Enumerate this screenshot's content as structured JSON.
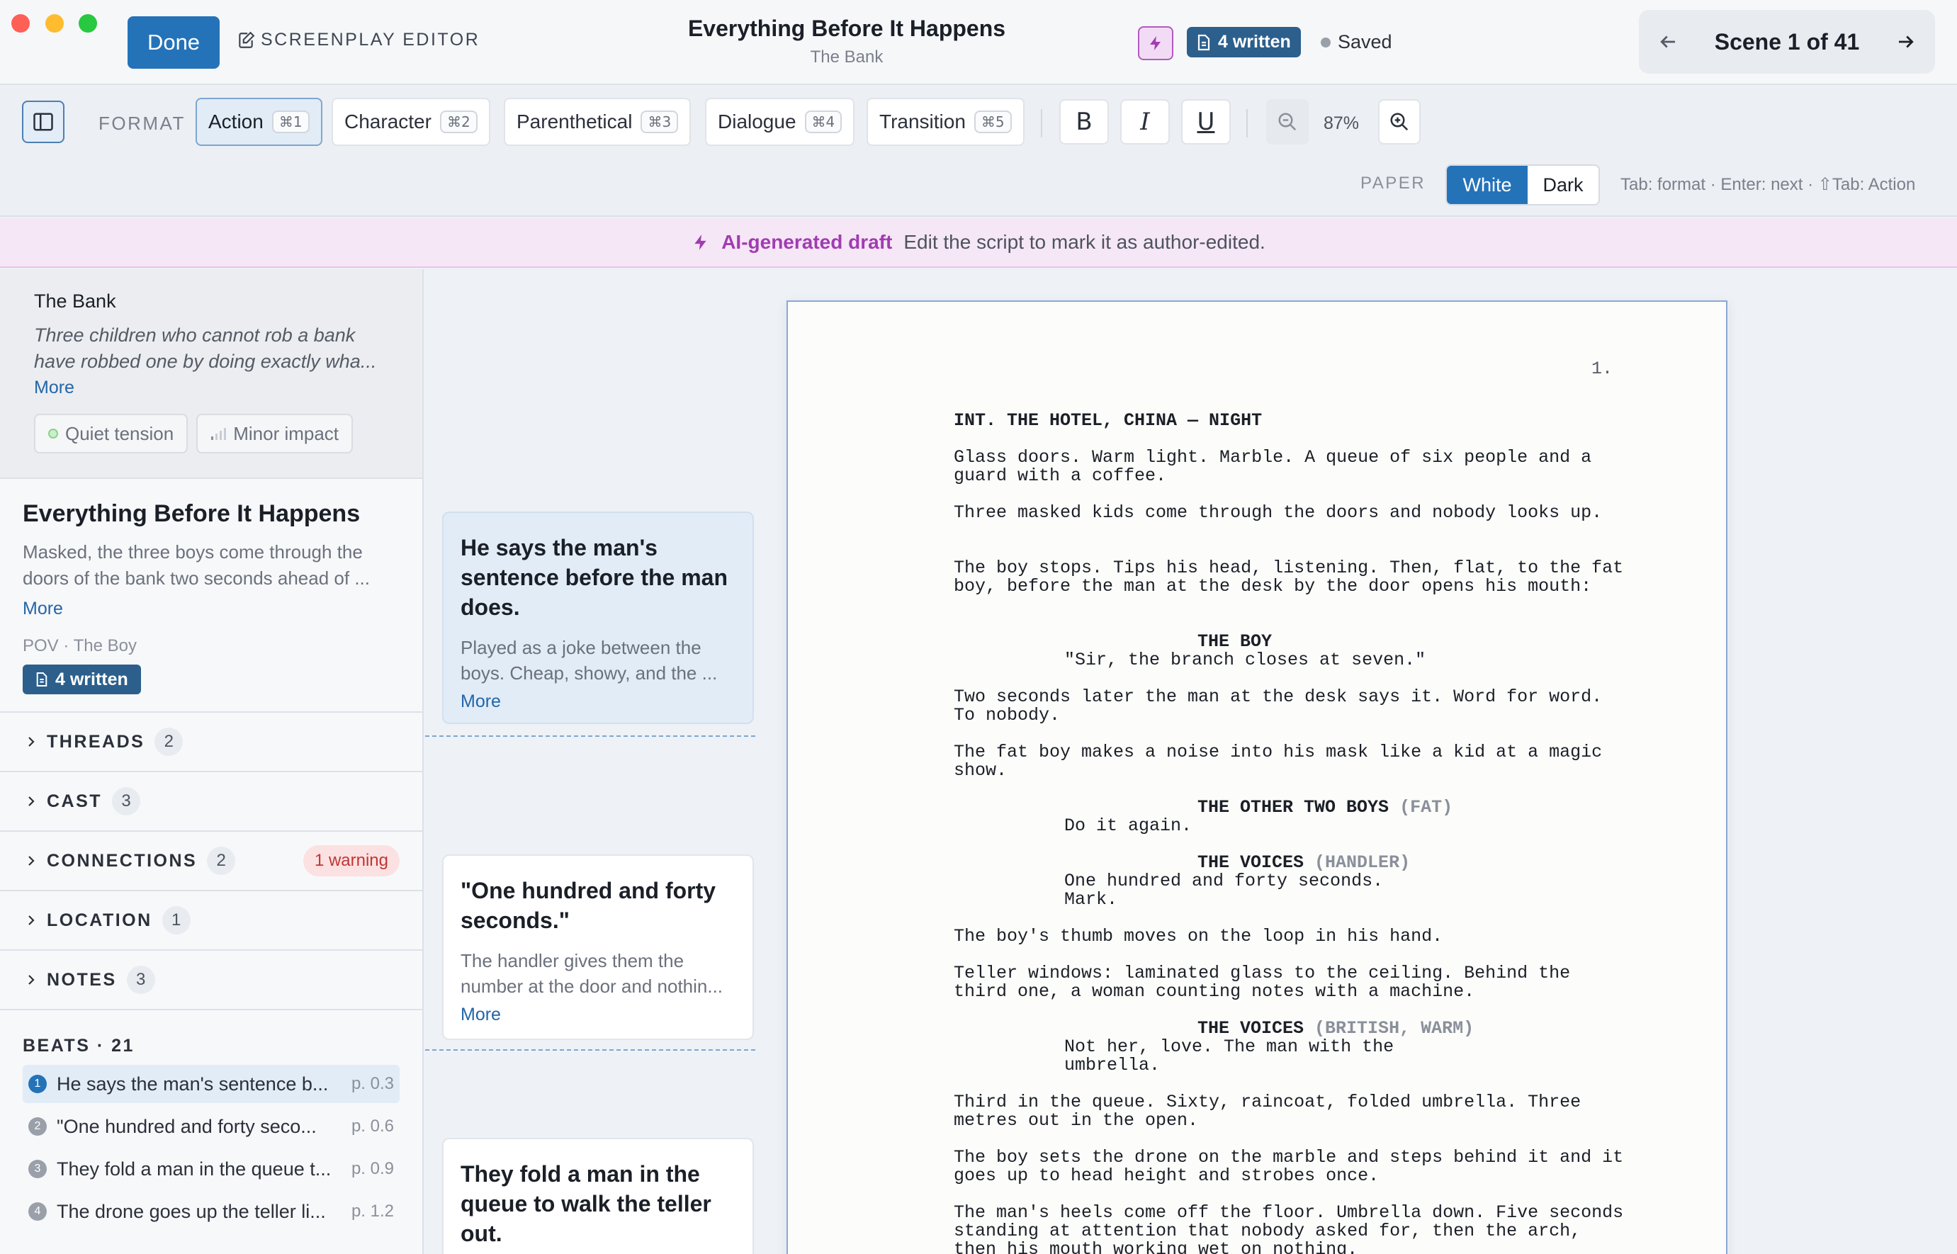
{
  "window": {
    "done_label": "Done",
    "editor_label": "SCREENPLAY EDITOR",
    "title": "Everything Before It Happens",
    "subtitle": "The Bank",
    "written_badge": "4 written",
    "save_status": "Saved",
    "scene_nav": "Scene 1 of 41"
  },
  "toolbar": {
    "format_label": "FORMAT",
    "formats": [
      {
        "label": "Action",
        "shortcut": "⌘1"
      },
      {
        "label": "Character",
        "shortcut": "⌘2"
      },
      {
        "label": "Parenthetical",
        "shortcut": "⌘3"
      },
      {
        "label": "Dialogue",
        "shortcut": "⌘4"
      },
      {
        "label": "Transition",
        "shortcut": "⌘5"
      }
    ],
    "active_format": "Action",
    "bold": "B",
    "italic": "I",
    "underline": "U",
    "zoom": "87%",
    "paper_label": "PAPER",
    "paper_white": "White",
    "paper_dark": "Dark",
    "paper_selected": "White",
    "hint": "Tab: format · Enter: next · ⇧Tab: Action"
  },
  "banner": {
    "label": "AI-generated draft",
    "text": "Edit the script to mark it as author-edited."
  },
  "sidebar": {
    "story_title": "The Bank",
    "story_desc": "Three children who cannot rob a bank have robbed one by doing exactly wha...",
    "more": "More",
    "chips": [
      {
        "label": "Quiet tension",
        "icon": "dot-icon"
      },
      {
        "label": "Minor impact",
        "icon": "signal-bars-icon"
      }
    ],
    "scene_title": "Everything Before It Happens",
    "scene_desc": "Masked, the three boys come through the doors of the bank two seconds ahead of ...",
    "pov": "POV · The Boy",
    "scene_badge": "4 written",
    "sections": [
      {
        "name": "THREADS",
        "count": "2"
      },
      {
        "name": "CAST",
        "count": "3"
      },
      {
        "name": "CONNECTIONS",
        "count": "2",
        "warning": "1 warning"
      },
      {
        "name": "LOCATION",
        "count": "1"
      },
      {
        "name": "NOTES",
        "count": "3"
      }
    ],
    "beats_label": "BEATS · 21",
    "beats": [
      {
        "num": "1",
        "text": "He says the man's sentence b...",
        "page": "p. 0.3"
      },
      {
        "num": "2",
        "text": "\"One hundred and forty seco...",
        "page": "p. 0.6"
      },
      {
        "num": "3",
        "text": "They fold a man in the queue t...",
        "page": "p. 0.9"
      },
      {
        "num": "4",
        "text": "The drone goes up the teller li...",
        "page": "p. 1.2"
      }
    ]
  },
  "cards": [
    {
      "title": "He says the man's sentence before the man does.",
      "body": "Played as a joke between the boys. Cheap, showy, and the ...",
      "more": "More"
    },
    {
      "title": "\"One hundred and forty seconds.\"",
      "body": "The handler gives them the number at the door and nothin...",
      "more": "More"
    },
    {
      "title": "They fold a man in the queue to walk the teller out.",
      "body": "",
      "more": ""
    }
  ],
  "script": {
    "page_number": "1.",
    "scene_heading": "INT. THE HOTEL, CHINA — NIGHT",
    "a1": "Glass doors. Warm light. Marble. A queue of six people and a guard with a coffee.",
    "a2": "Three masked kids come through the doors and nobody looks up.",
    "a3": "The boy stops. Tips his head, listening. Then, flat, to the fat boy, before the man at the desk by the door opens his mouth:",
    "c1": "THE BOY",
    "d1": "\"Sir, the branch closes at seven.\"",
    "a4": "Two seconds later the man at the desk says it. Word for word. To nobody.",
    "a5": "The fat boy makes a noise into his mask like a kid at a magic show.",
    "c2": "THE OTHER TWO BOYS",
    "c2_ext": "(FAT)",
    "d2": "Do it again.",
    "c3": "THE VOICES",
    "c3_ext": "(HANDLER)",
    "d3": "One hundred and forty seconds. Mark.",
    "a6": "The boy's thumb moves on the loop in his hand.",
    "a7": "Teller windows: laminated glass to the ceiling. Behind the third one, a woman counting notes with a machine.",
    "c4": "THE VOICES",
    "c4_ext": "(BRITISH, WARM)",
    "d4": "Not her, love. The man with the umbrella.",
    "a8": "Third in the queue. Sixty, raincoat, folded umbrella. Three metres out in the open.",
    "a9": "The boy sets the drone on the marble and steps behind it and it goes up to head height and strobes once.",
    "a10": "The man's heels come off the floor. Umbrella down. Five seconds standing at attention that nobody asked for, then the arch, then his mouth working wet on nothing."
  },
  "colors": {
    "accent": "#2473b9",
    "badge": "#2c5f8c",
    "ai_purple": "#a13cb2",
    "warning": "#c23535"
  }
}
